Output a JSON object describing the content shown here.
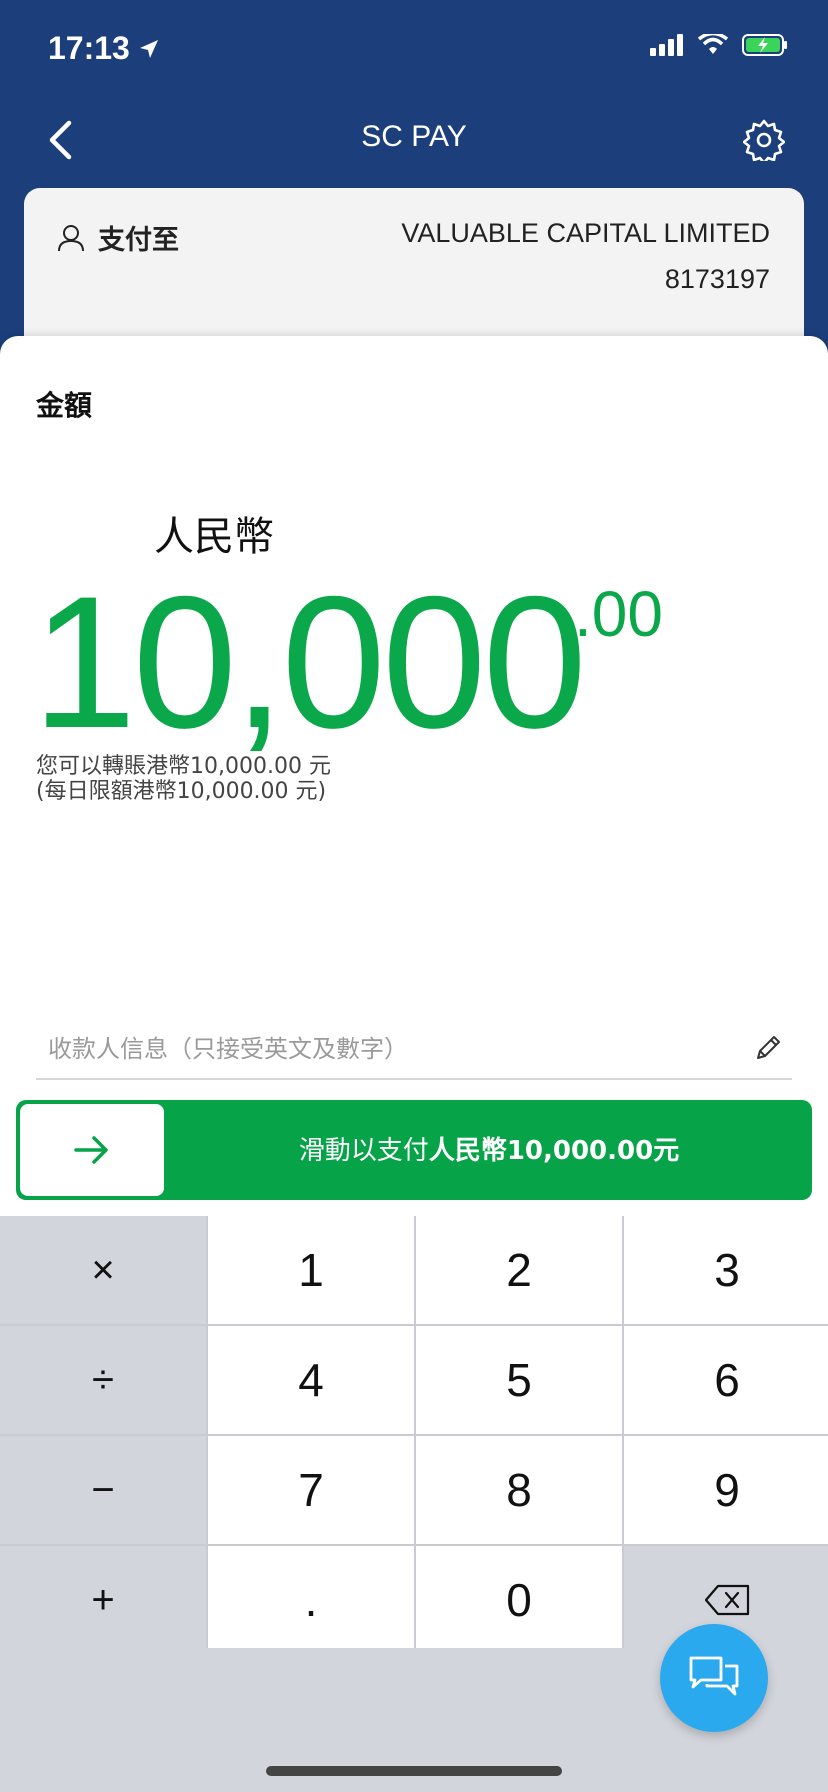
{
  "status": {
    "time": "17:13"
  },
  "nav": {
    "title": "SC PAY"
  },
  "payee": {
    "label": "支付至",
    "name": "VALUABLE CAPITAL LIMITED",
    "id": "8173197"
  },
  "amount": {
    "label": "金額",
    "currency": "人民幣",
    "integer": "10,000",
    "cents": ".00",
    "limit_line1": "您可以轉賬港幣10,000.00 元",
    "limit_line2": "(每日限額港幣10,000.00 元)"
  },
  "memo": {
    "placeholder": "收款人信息（只接受英文及數字）"
  },
  "slide": {
    "prefix": "滑動以支付",
    "amount_text": "人民幣10,000.00元"
  },
  "keypad": {
    "op_multiply": "×",
    "op_divide": "÷",
    "op_minus": "−",
    "op_plus": "+",
    "k1": "1",
    "k2": "2",
    "k3": "3",
    "k4": "4",
    "k5": "5",
    "k6": "6",
    "k7": "7",
    "k8": "8",
    "k9": "9",
    "dot": ".",
    "k0": "0"
  },
  "colors": {
    "header_bg": "#1c3f7c",
    "accent_green": "#07a348",
    "amount_green": "#0aa84a",
    "chat_blue": "#2aa9ee"
  }
}
